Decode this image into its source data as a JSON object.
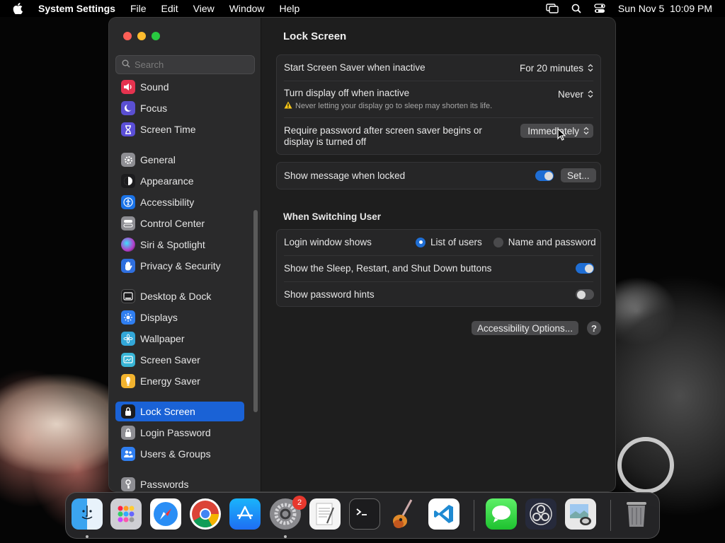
{
  "menubar": {
    "app_name": "System Settings",
    "menus": [
      "File",
      "Edit",
      "View",
      "Window",
      "Help"
    ],
    "datetime": "Sun Nov 5  10:09 PM"
  },
  "sidebar": {
    "search_placeholder": "Search",
    "items": [
      {
        "label": "Sound",
        "icon": "speaker-icon",
        "color": "#e5334f"
      },
      {
        "label": "Focus",
        "icon": "moon-icon",
        "color": "#5a4fd1"
      },
      {
        "label": "Screen Time",
        "icon": "hourglass-icon",
        "color": "#5b4fd8"
      },
      {
        "label": "General",
        "icon": "gear-icon",
        "color": "#8e8e93"
      },
      {
        "label": "Appearance",
        "icon": "appearance-icon",
        "color": "#1c1c1e"
      },
      {
        "label": "Accessibility",
        "icon": "accessibility-icon",
        "color": "#1a73e8"
      },
      {
        "label": "Control Center",
        "icon": "control-center-icon",
        "color": "#8e8e93"
      },
      {
        "label": "Siri & Spotlight",
        "icon": "siri-icon",
        "color": "#b43cc8"
      },
      {
        "label": "Privacy & Security",
        "icon": "hand-icon",
        "color": "#2f6fdf"
      },
      {
        "label": "Desktop & Dock",
        "icon": "dock-icon",
        "color": "#1c1c1e"
      },
      {
        "label": "Displays",
        "icon": "sun-icon",
        "color": "#2f7ef0"
      },
      {
        "label": "Wallpaper",
        "icon": "flower-icon",
        "color": "#33a7d8"
      },
      {
        "label": "Screen Saver",
        "icon": "screen-saver-icon",
        "color": "#38b5d6"
      },
      {
        "label": "Energy Saver",
        "icon": "battery-icon",
        "color": "#f2b32e"
      },
      {
        "label": "Lock Screen",
        "icon": "lock-icon",
        "color": "#1c1c1e"
      },
      {
        "label": "Login Password",
        "icon": "lock-icon",
        "color": "#8e8e93"
      },
      {
        "label": "Users & Groups",
        "icon": "users-icon",
        "color": "#2f7ef0"
      },
      {
        "label": "Passwords",
        "icon": "key-icon",
        "color": "#8e8e93"
      }
    ],
    "active": "Lock Screen"
  },
  "content": {
    "title": "Lock Screen",
    "screen_saver": {
      "label": "Start Screen Saver when inactive",
      "value": "For 20 minutes"
    },
    "display_off": {
      "label": "Turn display off when inactive",
      "value": "Never",
      "warning": "Never letting your display go to sleep may shorten its life."
    },
    "require_password": {
      "label_line1": "Require password after screen saver begins or",
      "label_line2": "display is turned off",
      "value": "Immediately"
    },
    "show_message": {
      "label": "Show message when locked",
      "on": true,
      "button": "Set..."
    },
    "switching_title": "When Switching User",
    "login_window": {
      "label": "Login window shows",
      "options": [
        "List of users",
        "Name and password"
      ],
      "selected": "List of users"
    },
    "sleep_buttons": {
      "label": "Show the Sleep, Restart, and Shut Down buttons",
      "on": true
    },
    "password_hints": {
      "label": "Show password hints",
      "on": false
    },
    "accessibility_button": "Accessibility Options...",
    "help_button": "?"
  },
  "dock": {
    "apps": [
      "finder-icon",
      "launchpad-icon",
      "safari-icon",
      "chrome-icon",
      "app-store-icon",
      "system-settings-icon",
      "textedit-icon",
      "terminal-icon",
      "garageband-icon",
      "vscode-icon",
      "messages-icon",
      "obs-icon",
      "preview-icon",
      "trash-icon"
    ],
    "settings_badge": "2"
  },
  "colors": {
    "accent": "#1a62d6",
    "toggle_on": "#1f6ed4"
  }
}
